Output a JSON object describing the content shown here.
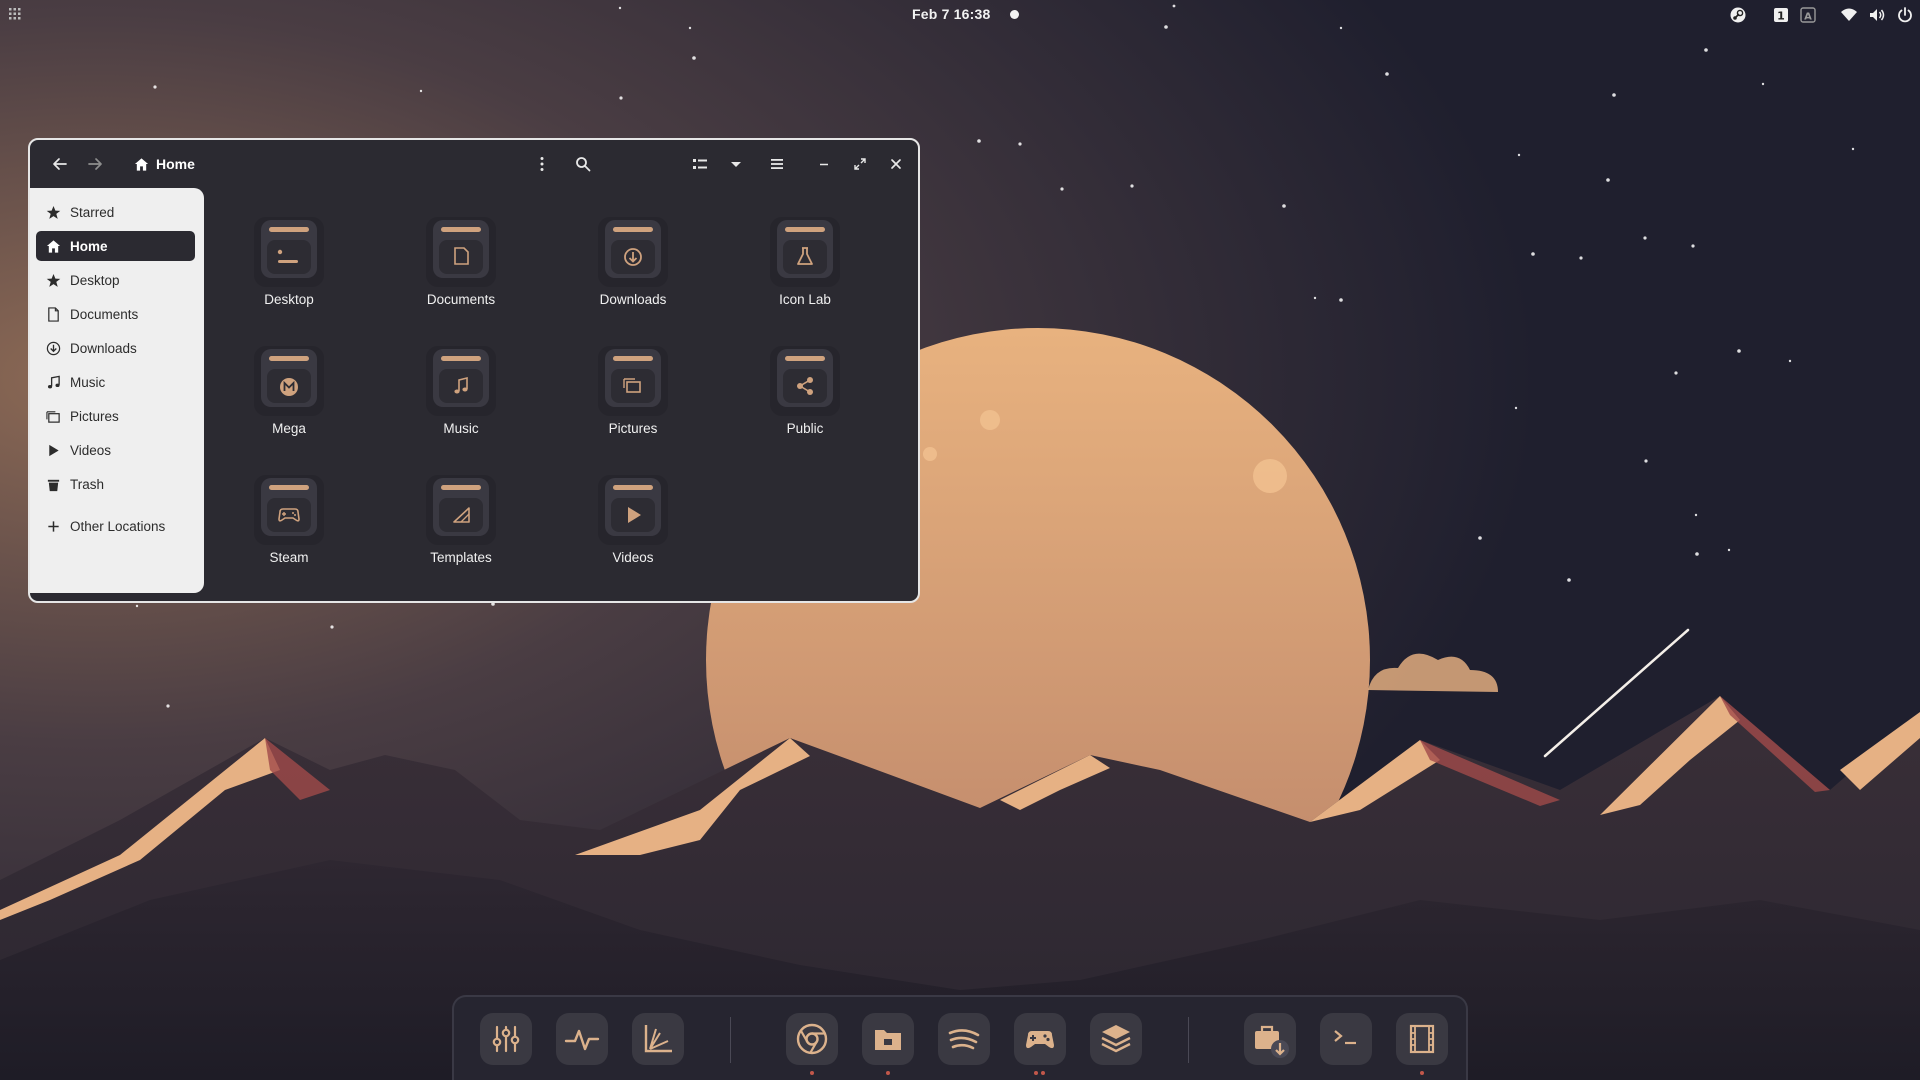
{
  "topbar": {
    "clock": "Feb 7  16:38",
    "icons": [
      "activities-grid-icon",
      "steam-icon",
      "keyboard-layout-icon",
      "input-method-icon",
      "wifi-icon",
      "volume-icon",
      "power-icon"
    ]
  },
  "window": {
    "location": "Home",
    "header_icons": [
      "back-arrow-icon",
      "forward-arrow-icon",
      "kebab-menu-icon",
      "search-icon",
      "view-toggle-icon",
      "view-options-icon",
      "hamburger-menu-icon",
      "minimize-icon",
      "maximize-icon",
      "close-icon"
    ]
  },
  "sidebar": {
    "items": [
      {
        "label": "Starred",
        "icon": "star-icon"
      },
      {
        "label": "Home",
        "icon": "home-icon"
      },
      {
        "label": "Desktop",
        "icon": "star-icon"
      },
      {
        "label": "Documents",
        "icon": "document-icon"
      },
      {
        "label": "Downloads",
        "icon": "download-icon"
      },
      {
        "label": "Music",
        "icon": "music-note-icon"
      },
      {
        "label": "Pictures",
        "icon": "picture-icon"
      },
      {
        "label": "Videos",
        "icon": "play-icon"
      },
      {
        "label": "Trash",
        "icon": "trash-icon"
      },
      {
        "label": "Other Locations",
        "icon": "plus-icon"
      }
    ],
    "active": "Home"
  },
  "folders": [
    {
      "label": "Desktop",
      "icon": "folder-desktop-icon"
    },
    {
      "label": "Documents",
      "icon": "folder-documents-icon"
    },
    {
      "label": "Downloads",
      "icon": "folder-downloads-icon"
    },
    {
      "label": "Icon Lab",
      "icon": "folder-iconlab-icon"
    },
    {
      "label": "Mega",
      "icon": "folder-mega-icon"
    },
    {
      "label": "Music",
      "icon": "folder-music-icon"
    },
    {
      "label": "Pictures",
      "icon": "folder-pictures-icon"
    },
    {
      "label": "Public",
      "icon": "folder-public-icon"
    },
    {
      "label": "Steam",
      "icon": "folder-steam-icon"
    },
    {
      "label": "Templates",
      "icon": "folder-templates-icon"
    },
    {
      "label": "Videos",
      "icon": "folder-videos-icon"
    }
  ],
  "dock": {
    "apps": [
      "equalizer-app-icon",
      "system-monitor-app-icon",
      "graph-app-icon",
      "chrome-app-icon",
      "files-app-icon",
      "spotify-app-icon",
      "game-controller-app-icon",
      "layers-app-icon",
      "software-store-app-icon",
      "terminal-app-icon",
      "video-editor-app-icon"
    ]
  },
  "colors": {
    "accent": "#d9a67a",
    "window_bg": "#2b2a31",
    "sidebar_bg": "#efefef",
    "moon": "#e0a878",
    "sky_top": "#262535",
    "mountain_dark": "#2b2630",
    "mountain_highlight": "#e6b184",
    "running_indicator": "#c2574a"
  }
}
